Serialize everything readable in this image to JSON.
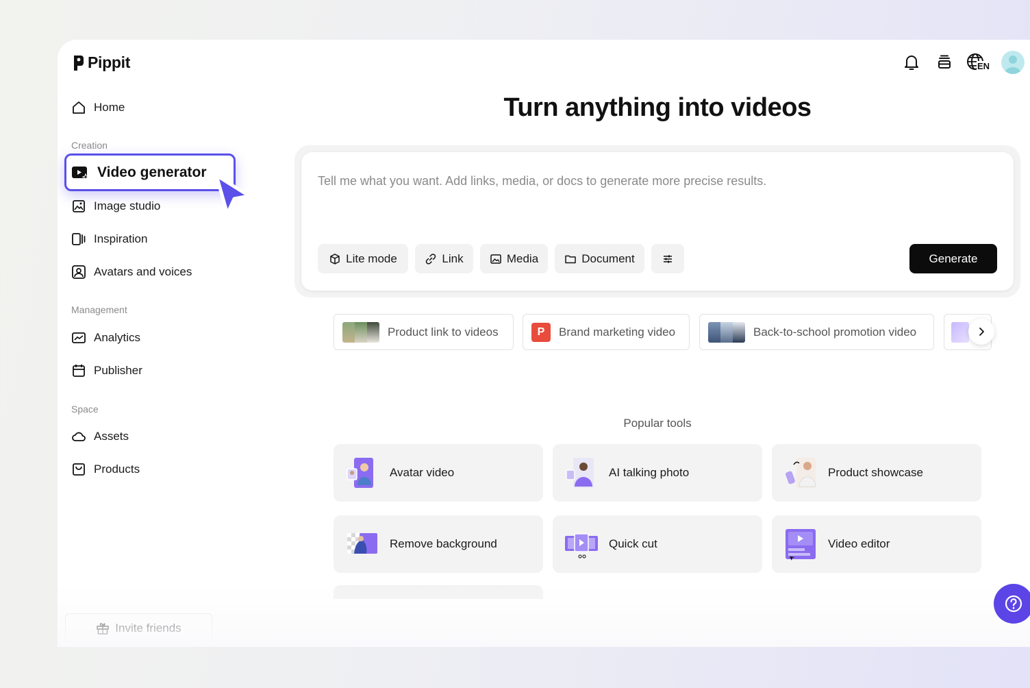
{
  "app": {
    "name": "Pippit"
  },
  "header": {
    "language": "EN"
  },
  "sidebar": {
    "home": "Home",
    "creation_label": "Creation",
    "creation_items": [
      "Video generator",
      "Image studio",
      "Inspiration",
      "Avatars and voices"
    ],
    "management_label": "Management",
    "management_items": [
      "Analytics",
      "Publisher"
    ],
    "space_label": "Space",
    "space_items": [
      "Assets",
      "Products"
    ],
    "invite": "Invite friends"
  },
  "main": {
    "title": "Turn anything into videos",
    "prompt_placeholder": "Tell me what you want. Add links, media, or docs to generate more precise results.",
    "chips": [
      "Lite mode",
      "Link",
      "Media",
      "Document"
    ],
    "generate": "Generate",
    "suggestions": [
      "Product link to videos",
      "Brand marketing video",
      "Back-to-school promotion video"
    ],
    "suggestion_badge": "P",
    "popular_label": "Popular tools",
    "tools": [
      "Avatar video",
      "AI talking photo",
      "Product showcase",
      "Remove background",
      "Quick cut",
      "Video editor"
    ]
  },
  "colors": {
    "accent": "#5b50ea",
    "brand_badge": "#e94b3c",
    "tool_purple": "#8b6cf0"
  }
}
